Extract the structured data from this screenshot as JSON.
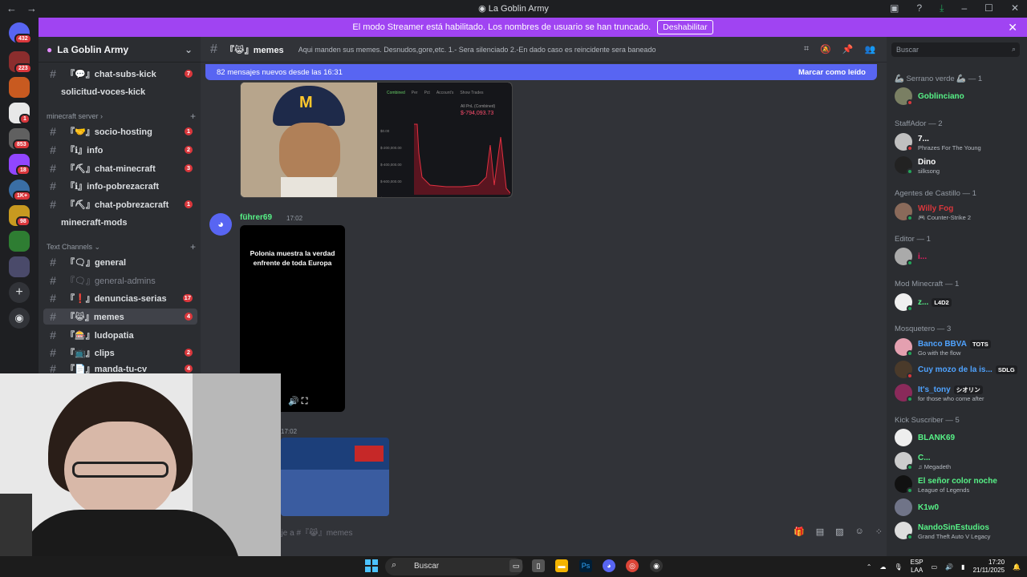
{
  "window": {
    "title": "La Goblin Army",
    "back": "←",
    "forward": "→"
  },
  "banner": {
    "text": "El modo Streamer está habilitado. Los nombres de usuario se han truncado.",
    "button": "Deshabilitar",
    "close": "✕"
  },
  "servers": [
    {
      "badge": "432"
    },
    {
      "badge": "223"
    },
    {
      "badge": ""
    },
    {
      "badge": "1"
    },
    {
      "badge": "853"
    },
    {
      "badge": "18"
    },
    {
      "badge": "1K+"
    },
    {
      "badge": "98"
    },
    {
      "badge": ""
    },
    {
      "badge": ""
    }
  ],
  "guild": {
    "name": "La Goblin Army"
  },
  "channels": {
    "top": [
      {
        "name": "『💬』chat-subs-kick",
        "count": "7"
      },
      {
        "name": "solicitud-voces-kick",
        "count": ""
      }
    ],
    "cat1": "minecraft server",
    "mc": [
      {
        "name": "『🤝』socio-hosting",
        "count": "1"
      },
      {
        "name": "『ℹ』info",
        "count": "2"
      },
      {
        "name": "『⛏』chat-minecraft",
        "count": "3"
      },
      {
        "name": "『ℹ』info-pobrezacraft",
        "count": ""
      },
      {
        "name": "『⛏』chat-pobrezacraft",
        "count": "1"
      },
      {
        "name": "minecraft-mods",
        "count": ""
      }
    ],
    "cat2": "Text Channels",
    "text": [
      {
        "name": "『🗨』general",
        "count": ""
      },
      {
        "name": "『🗨』general-admins",
        "count": ""
      },
      {
        "name": "『❗』denuncias-serias",
        "count": "17"
      },
      {
        "name": "『😹』memes",
        "count": "4"
      },
      {
        "name": "『🎰』ludopatia",
        "count": ""
      },
      {
        "name": "『📺』clips",
        "count": "2"
      },
      {
        "name": "『📄』manda-tu-cv",
        "count": "4"
      }
    ]
  },
  "header": {
    "channel": "『😹』memes",
    "topic": "Aqui manden sus memes. Desnudos,gore,etc. 1.- Sera silenciado 2.-En dado caso es reincidente sera baneado",
    "search_placeholder": "Buscar"
  },
  "newbar": {
    "text": "82 mensajes nuevos desde las 16:31",
    "mark": "Marcar como leído"
  },
  "chart_panel": {
    "tabs": [
      "Combined",
      "Per",
      "Pct",
      "Account's",
      "Show Trades"
    ],
    "label": "All PnL (Combined)",
    "value": "$-794,093.73",
    "y": [
      "$0.00",
      "$-200,000.00",
      "$-400,000.00",
      "$-600,000.00",
      "$-800,000.00"
    ]
  },
  "message": {
    "author": "führer69",
    "time": "17:02",
    "video_text": "Polonia muestra la verdad enfrente de toda Europa",
    "time2": "17:02"
  },
  "input": {
    "placeholder": "saje a #『😹』memes"
  },
  "members": [
    {
      "group": "🦾 Serrano verde 🦾 — 1",
      "users": [
        {
          "name": "Goblinciano",
          "status": "",
          "color": "#57f287"
        }
      ]
    },
    {
      "group": "StaffAdor — 2",
      "users": [
        {
          "name": "7...",
          "status": "Phrazes For The Young",
          "color": "#ffffff"
        },
        {
          "name": "Dino",
          "status": "silksong",
          "color": "#ffffff"
        }
      ]
    },
    {
      "group": "Agentes de Castillo — 1",
      "users": [
        {
          "name": "Willy Fog",
          "status": "🎮 Counter-Strike 2",
          "color": "#da373c"
        }
      ]
    },
    {
      "group": "Editor — 1",
      "users": [
        {
          "name": "i...",
          "status": "",
          "color": "#e91e63"
        }
      ]
    },
    {
      "group": "Mod Minecraft — 1",
      "users": [
        {
          "name": "z...",
          "status": "",
          "tag": "L4D2",
          "color": "#57f287"
        }
      ]
    },
    {
      "group": "Mosquetero — 3",
      "users": [
        {
          "name": "Banco BBVA",
          "status": "Go with the flow",
          "tag": "TOTS",
          "color": "#4fa3ff"
        },
        {
          "name": "Cuy mozo de la is...",
          "status": "",
          "tag": "SDLG",
          "color": "#4fa3ff"
        },
        {
          "name": "It's_tony",
          "status": "for those who come after",
          "tag": "シオリン",
          "color": "#4fa3ff"
        }
      ]
    },
    {
      "group": "Kick Suscriber — 5",
      "users": [
        {
          "name": "BLANK69",
          "status": "",
          "color": "#57f287"
        },
        {
          "name": "C...",
          "status": "♫ Megadeth",
          "color": "#57f287"
        },
        {
          "name": "El señor color noche",
          "status": "League of Legends",
          "color": "#57f287"
        },
        {
          "name": "K1w0",
          "status": "",
          "color": "#57f287"
        },
        {
          "name": "NandoSinEstudios",
          "status": "Grand Theft Auto V Legacy",
          "color": "#57f287"
        }
      ]
    }
  ],
  "taskbar": {
    "search": "Buscar",
    "lang1": "ESP",
    "lang2": "LAA",
    "time": "17:20",
    "date": "21/11/2025"
  }
}
